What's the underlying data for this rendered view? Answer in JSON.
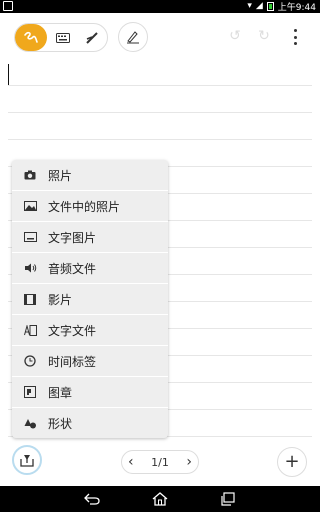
{
  "status_bar": {
    "time": "上午9:44"
  },
  "toolbar": {
    "modes": [
      {
        "name": "handwrite",
        "icon": "handwriting-icon",
        "active": true
      },
      {
        "name": "keyboard",
        "icon": "keyboard-icon",
        "active": false
      },
      {
        "name": "brush",
        "icon": "brush-icon",
        "active": false
      }
    ],
    "pen_icon": "pen-settings-icon",
    "undo_icon": "undo-icon",
    "redo_icon": "redo-icon",
    "more_icon": "more-vert-icon"
  },
  "insert_menu": {
    "items": [
      {
        "label": "照片",
        "icon": "camera-icon"
      },
      {
        "label": "文件中的照片",
        "icon": "gallery-icon"
      },
      {
        "label": "文字图片",
        "icon": "text-image-icon"
      },
      {
        "label": "音频文件",
        "icon": "audio-icon"
      },
      {
        "label": "影片",
        "icon": "video-icon"
      },
      {
        "label": "文字文件",
        "icon": "text-file-icon"
      },
      {
        "label": "时间标签",
        "icon": "clock-icon"
      },
      {
        "label": "图章",
        "icon": "stamp-icon"
      },
      {
        "label": "形状",
        "icon": "shape-icon"
      }
    ]
  },
  "bottom_bar": {
    "page_indicator": "1/1",
    "prev_label": "‹",
    "next_label": "›",
    "add_label": "+"
  },
  "colors": {
    "accent": "#f0a81c",
    "menu_bg": "#eeeeee",
    "ruled_line": "#e6e6e6",
    "insert_ring": "#b9dcef"
  }
}
